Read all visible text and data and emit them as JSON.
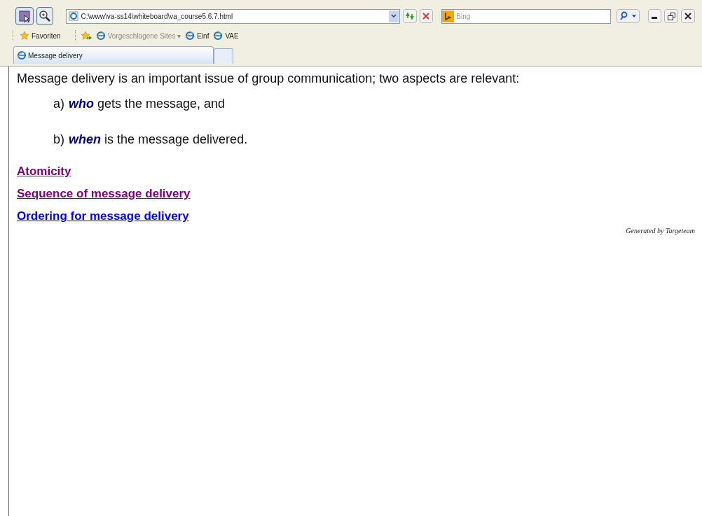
{
  "address_bar": {
    "url": "C:\\www\\va-ss14\\whiteboard\\va_course5.6.7.html"
  },
  "search": {
    "placeholder": "Bing"
  },
  "favorites_bar": {
    "favorites": "Favoriten",
    "links": [
      {
        "label": "Vorgeschlagene Sites ▾",
        "kind": "suggested"
      },
      {
        "label": "Einf",
        "kind": "page"
      },
      {
        "label": "VAE",
        "kind": "page"
      }
    ]
  },
  "tabs": [
    {
      "label": "Message delivery",
      "selected": true
    },
    {
      "selected": false
    }
  ],
  "content": {
    "intro": "Message delivery is an important issue of group communication; two aspects are relevant:",
    "items": [
      {
        "marker": "a)",
        "keyword": "who",
        "text": "gets the message, and"
      },
      {
        "marker": "b)",
        "keyword": "when",
        "text": "is the message delivered."
      }
    ],
    "links": [
      {
        "label": "Atomicity",
        "visited": true
      },
      {
        "label": "Sequence of message delivery",
        "visited": true
      },
      {
        "label": "Ordering for message delivery",
        "visited": false
      }
    ],
    "footer": "Generated by Targeteam"
  }
}
